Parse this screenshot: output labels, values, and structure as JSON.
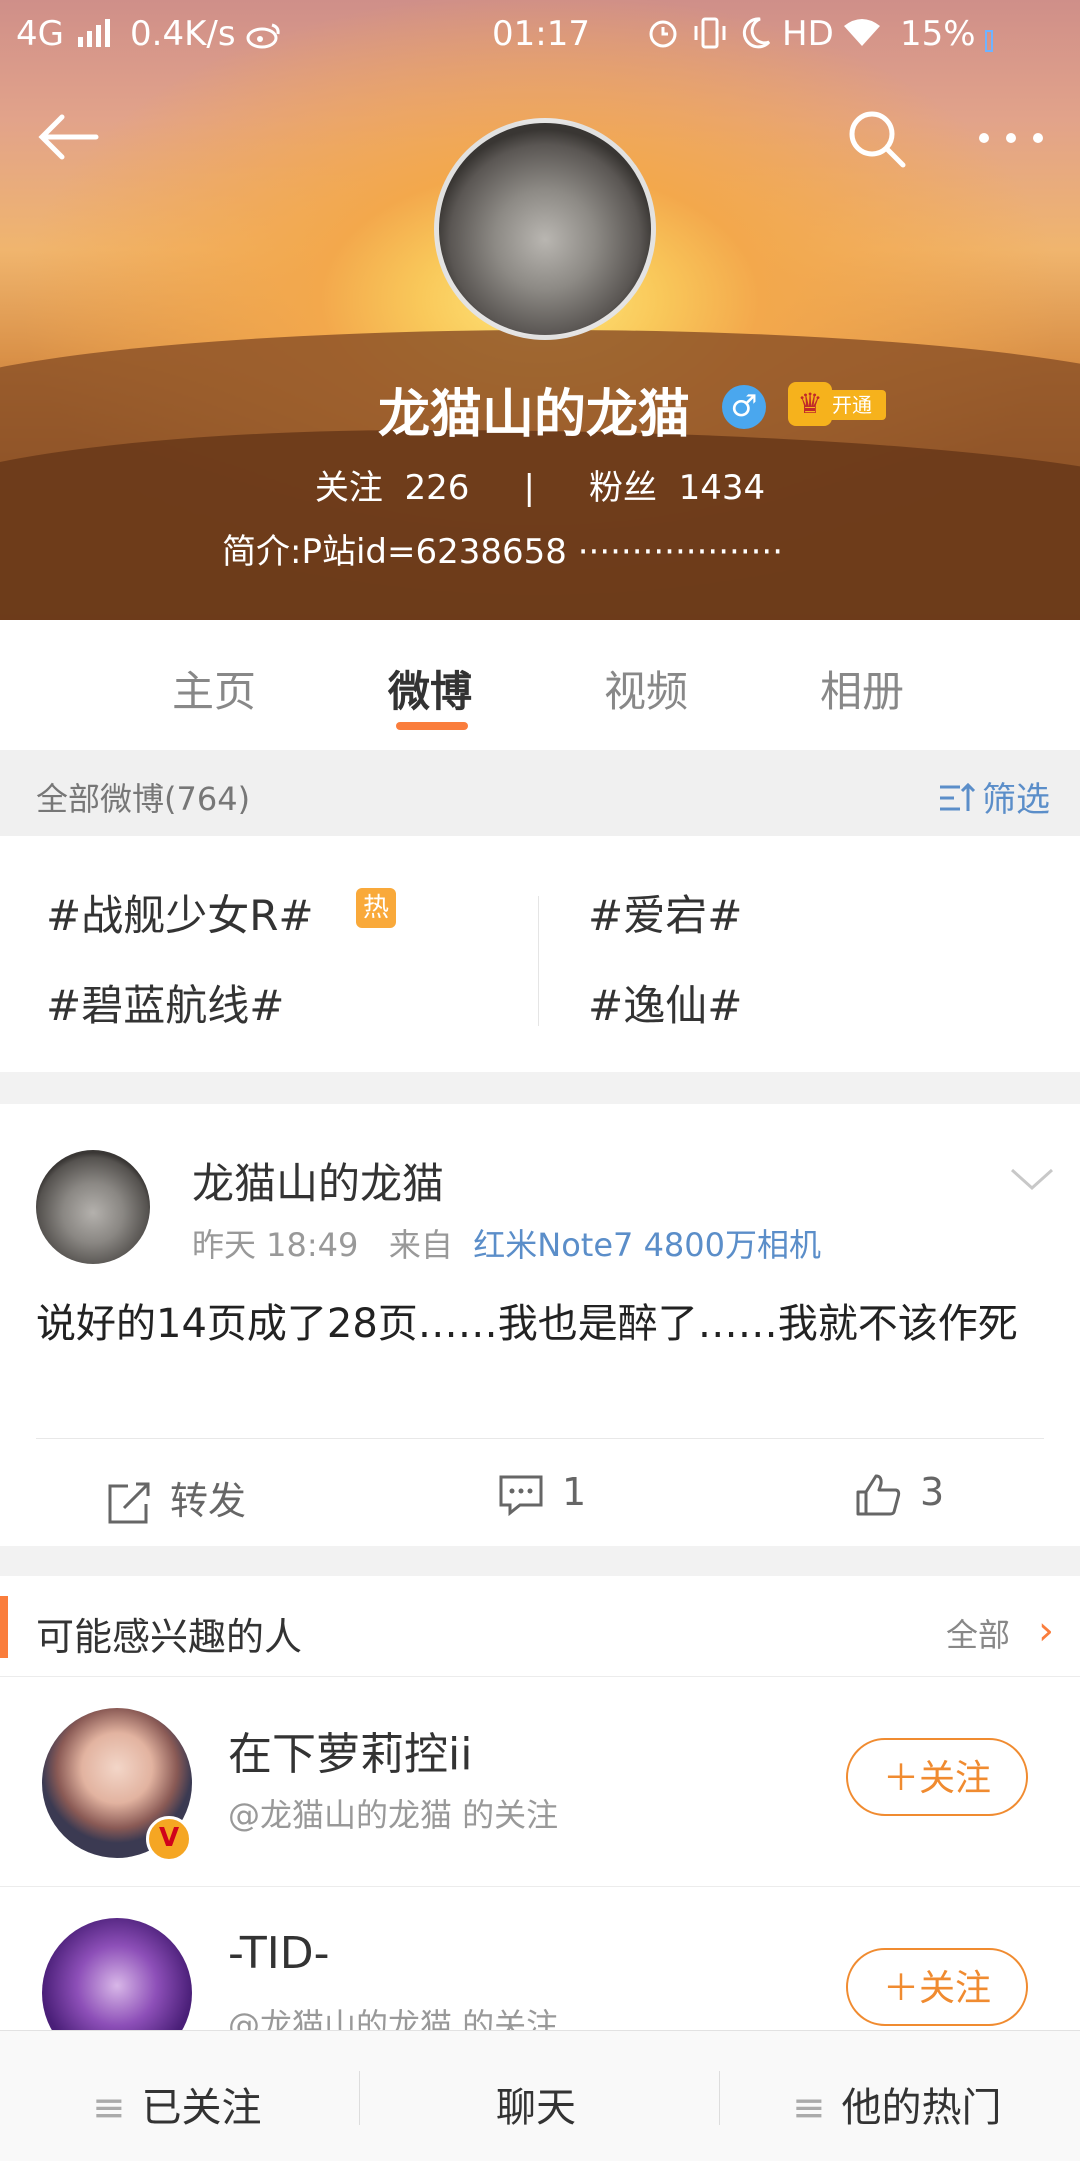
{
  "status_bar": {
    "network": "4G",
    "speed": "0.4K/s",
    "time": "01:17",
    "hd": "HD",
    "battery": "15%"
  },
  "profile": {
    "name": "龙猫山的龙猫",
    "gender_symbol": "♂",
    "vip_label": "开通",
    "following_label": "关注",
    "following_count": "226",
    "separator": "|",
    "fans_label": "粉丝",
    "fans_count": "1434",
    "bio": "简介:P站id=6238658 ···················"
  },
  "tabs": [
    {
      "label": "主页"
    },
    {
      "label": "微博"
    },
    {
      "label": "视频"
    },
    {
      "label": "相册"
    }
  ],
  "filter_bar": {
    "all_label": "全部微博(764)",
    "filter_label": "筛选"
  },
  "topics": [
    {
      "label": "#战舰少女R#",
      "hot": "热"
    },
    {
      "label": "#爱宕#"
    },
    {
      "label": "#碧蓝航线#"
    },
    {
      "label": "#逸仙#"
    }
  ],
  "post": {
    "author": "龙猫山的龙猫",
    "time": "昨天 18:49",
    "from_label": "来自",
    "source": "红米Note7 4800万相机",
    "text": "说好的14页成了28页……我也是醉了……我就不该作死",
    "repost_label": "转发",
    "comment_count": "1",
    "like_count": "3"
  },
  "suggestions": {
    "title": "可能感兴趣的人",
    "all_label": "全部",
    "arrow": "›",
    "items": [
      {
        "name": "在下萝莉控ii",
        "sub": "@龙猫山的龙猫 的关注",
        "button": "＋关注",
        "badge": "V"
      },
      {
        "name": "-TID-",
        "sub": "@龙猫山的龙猫 的关注",
        "button": "＋关注"
      }
    ]
  },
  "bottom_bar": {
    "followed": "已关注",
    "chat": "聊天",
    "hot": "他的热门",
    "menu_icon": "≡"
  },
  "colors": {
    "accent": "#fa7d3c",
    "link": "#5b8ec9",
    "follow": "#f08b30"
  }
}
